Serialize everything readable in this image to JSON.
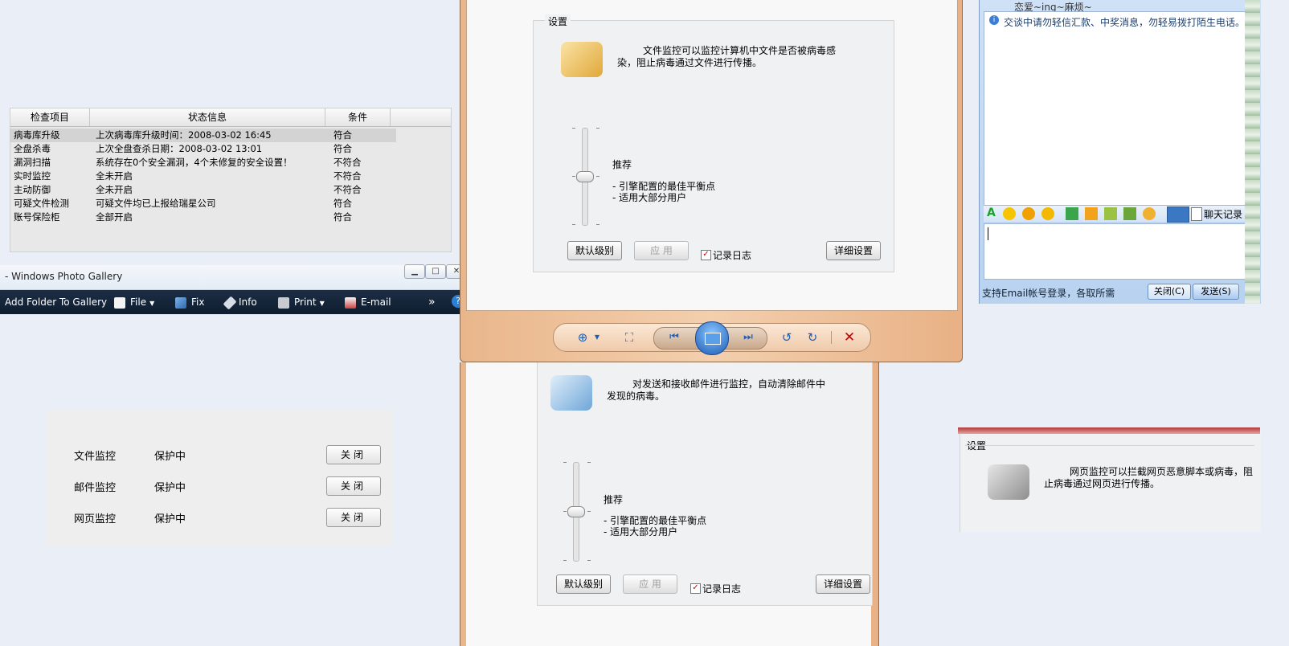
{
  "status_table": {
    "headers": [
      "检查项目",
      "状态信息",
      "条件"
    ],
    "rows": [
      {
        "item": "病毒库升级",
        "info": "上次病毒库升级时间：2008-03-02 16:45",
        "cond": "符合"
      },
      {
        "item": "全盘杀毒",
        "info": "上次全盘查杀日期：2008-03-02 13:01",
        "cond": "符合"
      },
      {
        "item": "漏洞扫描",
        "info": "系统存在0个安全漏洞，4个未修复的安全设置！",
        "cond": "不符合"
      },
      {
        "item": "实时监控",
        "info": "全未开启",
        "cond": "不符合"
      },
      {
        "item": "主动防御",
        "info": "全未开启",
        "cond": "不符合"
      },
      {
        "item": "可疑文件检测",
        "info": "可疑文件均已上报给瑞星公司",
        "cond": "符合"
      },
      {
        "item": "账号保险柜",
        "info": "全部开启",
        "cond": "符合"
      }
    ]
  },
  "photo_gallery": {
    "title": "- Windows Photo Gallery",
    "toolbar": {
      "add_folder": "Add Folder To Gallery",
      "file": "File",
      "fix": "Fix",
      "info": "Info",
      "print": "Print",
      "email": "E-mail",
      "more": "»",
      "help": "?"
    }
  },
  "monitor": {
    "items": [
      {
        "name": "文件监控",
        "status": "保护中",
        "button": "关闭"
      },
      {
        "name": "邮件监控",
        "status": "保护中",
        "button": "关闭"
      },
      {
        "name": "网页监控",
        "status": "保护中",
        "button": "关闭"
      }
    ]
  },
  "file_monitor": {
    "group_title": "设置",
    "description": "文件监控可以监控计算机中文件是否被病毒感染，阻止病毒通过文件进行传播。",
    "level_title": "推荐",
    "level_line1": "- 引擎配置的最佳平衡点",
    "level_line2": "- 适用大部分用户",
    "default_button": "默认级别",
    "apply_button": "应 用",
    "log_label": "记录日志",
    "detail_button": "详细设置"
  },
  "mail_monitor": {
    "description": "对发送和接收邮件进行监控，自动清除邮件中发现的病毒。",
    "level_title": "推荐",
    "level_line1": "- 引擎配置的最佳平衡点",
    "level_line2": "- 适用大部分用户",
    "default_button": "默认级别",
    "apply_button": "应 用",
    "log_label": "记录日志",
    "detail_button": "详细设置"
  },
  "web_monitor": {
    "group_title": "设置",
    "description": "网页监控可以拦截网页恶意脚本或病毒，阻止病毒通过网页进行传播。"
  },
  "chat": {
    "contact_signature": "恋爱~ing~麻烦~",
    "warning": "交谈中请勿轻信汇款、中奖消息，勿轻易拨打陌生电话。",
    "history_button": "聊天记录",
    "footer_text": "支持Email帐号登录，各取所需",
    "close_button": "关闭(C)",
    "send_button": "发送(S)"
  },
  "colors": {
    "toolbar_bg": "#0f1d2f",
    "window_frame": "#efcaa9",
    "accent_blue": "#1d5fb8",
    "danger_red": "#c00000"
  }
}
